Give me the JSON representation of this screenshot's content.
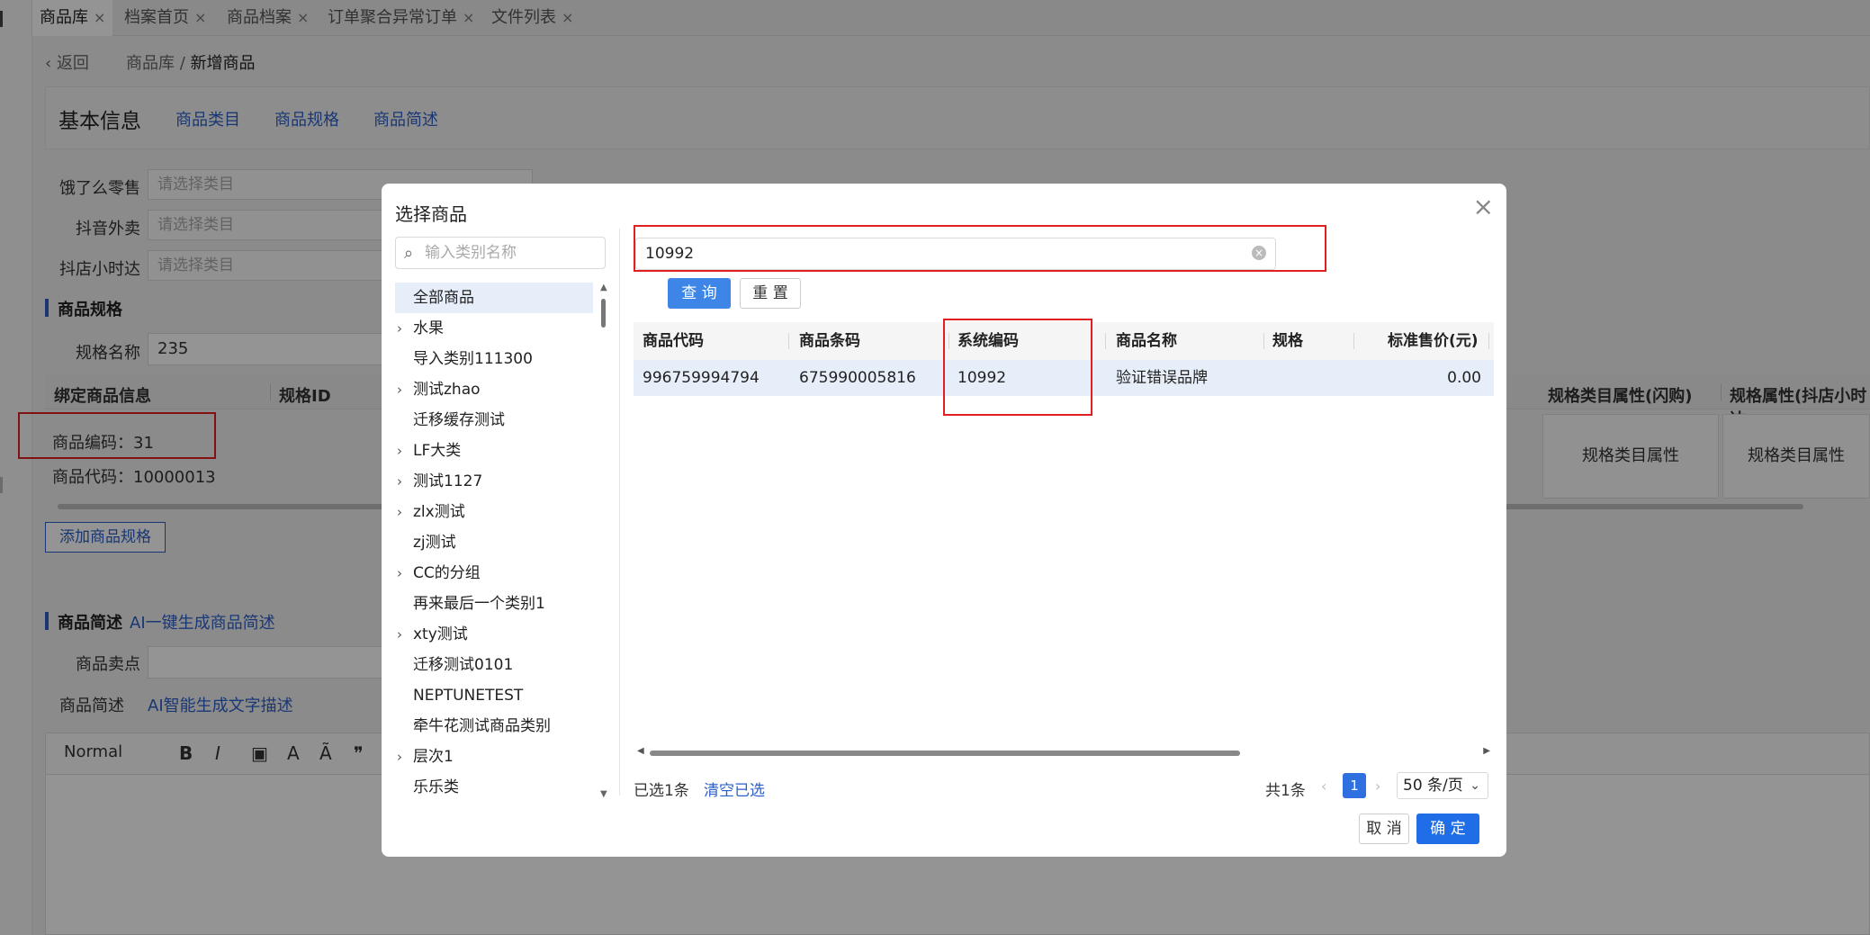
{
  "tabs": [
    {
      "label": "商品库",
      "active": true
    },
    {
      "label": "档案首页",
      "active": false
    },
    {
      "label": "商品档案",
      "active": false
    },
    {
      "label": "订单聚合异常订单",
      "active": false
    },
    {
      "label": "文件列表",
      "active": false
    }
  ],
  "tab_close_glyph": "×",
  "breadcrumb": {
    "back": "返回",
    "parent": "商品库",
    "separator": "/",
    "current": "新增商品"
  },
  "basic_info": {
    "title": "基本信息",
    "links": [
      "商品类目",
      "商品规格",
      "商品简述"
    ]
  },
  "category_rows": [
    {
      "label": "饿了么零售",
      "placeholder": "请选择类目"
    },
    {
      "label": "抖音外卖",
      "placeholder": "请选择类目"
    },
    {
      "label": "抖店小时达",
      "placeholder": "请选择类目"
    }
  ],
  "spec_section": {
    "title": "商品规格",
    "name_label": "规格名称",
    "name_value": "235",
    "columns": [
      "绑定商品信息",
      "规格ID",
      "规格类目属性(闪购)",
      "规格属性(抖店小时达"
    ],
    "goods_code": "商品编码：31",
    "goods_sku": "商品代码：10000013",
    "cell_a": "规格类目属性",
    "cell_b": "规格类目属性",
    "add_button": "添加商品规格"
  },
  "desc_section": {
    "title": "商品简述",
    "ai_link": "AI一键生成商品简述",
    "sell_label": "商品卖点",
    "desc_label": "商品简述",
    "ai_desc_link": "AI智能生成文字描述",
    "editor_format": "Normal"
  },
  "modal": {
    "title": "选择商品",
    "close_glyph": "×",
    "category_search_placeholder": "输入类别名称",
    "categories": [
      {
        "label": "全部商品",
        "has_children": false,
        "selected": true
      },
      {
        "label": "水果",
        "has_children": true
      },
      {
        "label": "导入类别111300",
        "has_children": false
      },
      {
        "label": "测试zhao",
        "has_children": true
      },
      {
        "label": "迁移缓存测试",
        "has_children": false
      },
      {
        "label": "LF大类",
        "has_children": true
      },
      {
        "label": "测试1127",
        "has_children": true
      },
      {
        "label": "zlx测试",
        "has_children": true
      },
      {
        "label": "zj测试",
        "has_children": false
      },
      {
        "label": "CC的分组",
        "has_children": true
      },
      {
        "label": "再来最后一个类别1",
        "has_children": false
      },
      {
        "label": "xty测试",
        "has_children": true
      },
      {
        "label": "迁移测试0101",
        "has_children": false
      },
      {
        "label": "NEPTUNETEST",
        "has_children": false
      },
      {
        "label": "牵牛花测试商品类别",
        "has_children": false
      },
      {
        "label": "层次1",
        "has_children": true
      },
      {
        "label": "乐乐类",
        "has_children": false
      }
    ],
    "search_value": "10992",
    "query_button": "查 询",
    "reset_button": "重 置",
    "table": {
      "headers": [
        "商品代码",
        "商品条码",
        "系统编码",
        "商品名称",
        "规格",
        "标准售价(元)"
      ],
      "rows": [
        {
          "code": "996759994794",
          "barcode": "675990005816",
          "system_code": "10992",
          "name": "验证错误品牌",
          "spec": "",
          "price": "0.00"
        }
      ]
    },
    "selected_text": "已选1条",
    "clear_selected": "清空已选",
    "total_text": "共1条",
    "current_page": "1",
    "page_size": "50 条/页",
    "cancel_button": "取 消",
    "ok_button": "确 定"
  }
}
